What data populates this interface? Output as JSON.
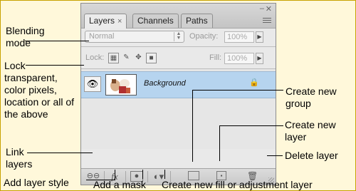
{
  "panel": {
    "tabs": [
      {
        "label": "Layers",
        "close": "×"
      },
      {
        "label": "Channels"
      },
      {
        "label": "Paths"
      }
    ],
    "blend_mode": "Normal",
    "opacity_label": "Opacity:",
    "opacity_value": "100%",
    "lock_label": "Lock:",
    "fill_label": "Fill:",
    "fill_value": "100%",
    "layer_name": "Background"
  },
  "callouts": {
    "blending_mode": "Blending mode",
    "lock": "Lock transparent, color pixels, location or all of the above",
    "link_layers": "Link layers",
    "add_layer_style": "Add layer style",
    "add_mask": "Add a mask",
    "create_fill": "Create new fill or adjustment layer",
    "create_group": "Create new group",
    "create_layer": "Create new layer",
    "delete_layer": "Delete layer"
  },
  "colors": {
    "background": "#fff8da",
    "selected_layer": "#b6d4ef"
  }
}
